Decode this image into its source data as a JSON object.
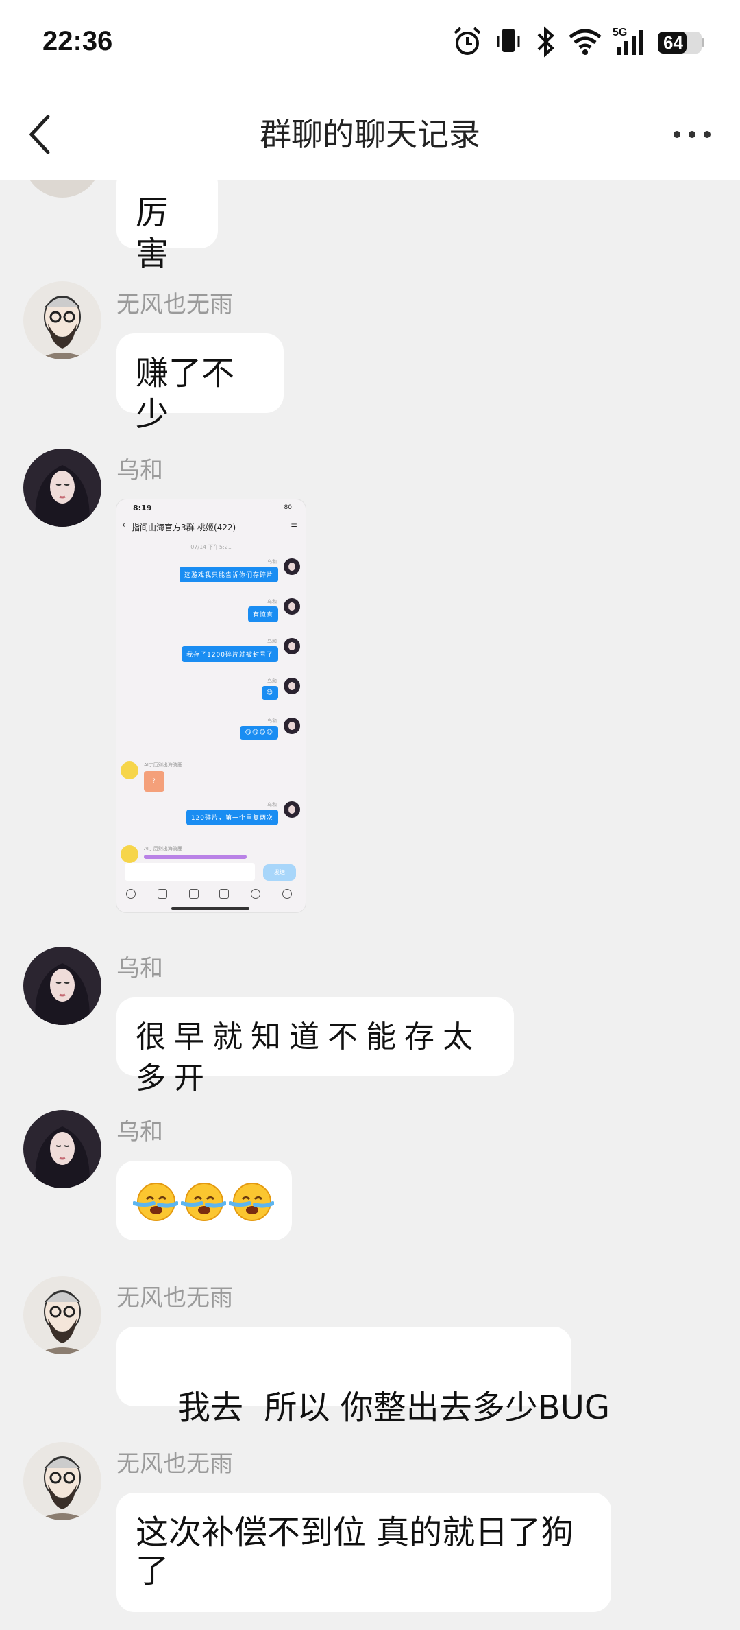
{
  "status_bar": {
    "time": "22:36",
    "battery": "64",
    "network": "5G"
  },
  "header": {
    "title": "群聊的聊天记录"
  },
  "messages": [
    {
      "sender": "",
      "text": "厉害"
    },
    {
      "sender": "无风也无雨",
      "text": "赚了不少"
    },
    {
      "sender": "乌和",
      "type": "image"
    },
    {
      "sender": "乌和",
      "text": "很早就知道不能存太多开"
    },
    {
      "sender": "乌和",
      "type": "emoji",
      "emoji": "crying-face-emoji ×3"
    },
    {
      "sender": "无风也无雨",
      "text": "我去  所以 你整出去多少BUG"
    },
    {
      "sender": "无风也无雨",
      "text_line1": "这次补偿不到位 真的就日了狗",
      "text_line2": "了"
    }
  ],
  "screenshot": {
    "time": "8:19",
    "battery": "80",
    "title": "指间山海官方3群-桃姬(422)",
    "date": "07/14 下午5:21",
    "sender": "乌和",
    "msgs": [
      "这游戏我只能告诉你们存碎片",
      "有惊喜",
      "我存了1200碎片就被封号了",
      "😊",
      "😋😋😋😋",
      "120碎片，第一个重复两次"
    ],
    "other_name": "AI丁历别出海骑鹿",
    "other_bubble": "?",
    "send_label": "发送"
  },
  "colors": {
    "background": "#f0f0f0",
    "bubble": "#ffffff",
    "name": "#9a9a9a",
    "mini_bubble": "#1a8df2"
  }
}
